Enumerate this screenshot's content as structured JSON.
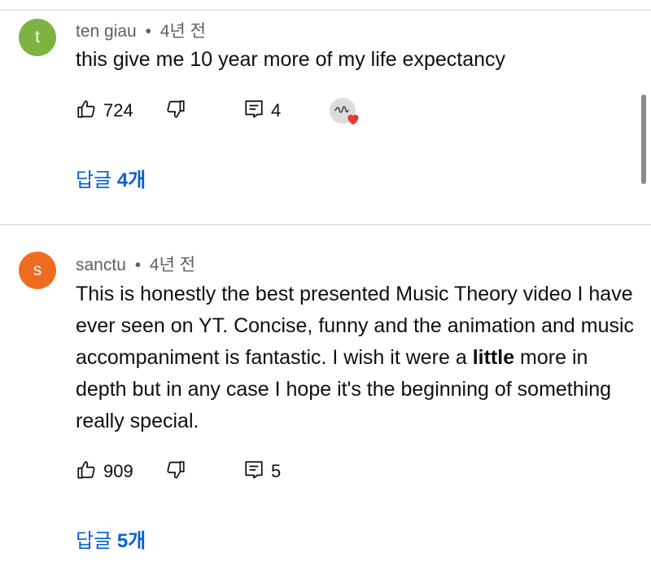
{
  "comments": [
    {
      "avatar_letter": "t",
      "avatar_color": "#7cb342",
      "author": "ten giau",
      "separator": "•",
      "time": "4년 전",
      "text": "this give me 10 year more of my life expectancy",
      "likes": "724",
      "reply_count": "4",
      "creator_heart": true,
      "replies_link_prefix": "답글 ",
      "replies_link_count": "4개"
    },
    {
      "avatar_letter": "s",
      "avatar_color": "#ef6c1f",
      "author": "sanctu",
      "separator": "•",
      "time": "4년 전",
      "text_before_bold": "This is honestly the best presented Music Theory video I have ever seen on YT. Concise, funny and the animation and music accompaniment is fantastic. I wish it were  a ",
      "text_bold": "little",
      "text_after_bold": " more in depth but in any case I hope it's the beginning of something really special.",
      "likes": "909",
      "reply_count": "5",
      "creator_heart": false,
      "replies_link_prefix": "답글 ",
      "replies_link_count": "5개"
    }
  ],
  "colors": {
    "link": "#065fd4",
    "meta_text": "#606060",
    "divider": "#e3e3e3",
    "heart": "#e53935"
  },
  "icons": {
    "like": "thumbs-up-icon",
    "dislike": "thumbs-down-icon",
    "reply": "comment-reply-icon",
    "creator_heart": "creator-heart-badge-icon"
  }
}
